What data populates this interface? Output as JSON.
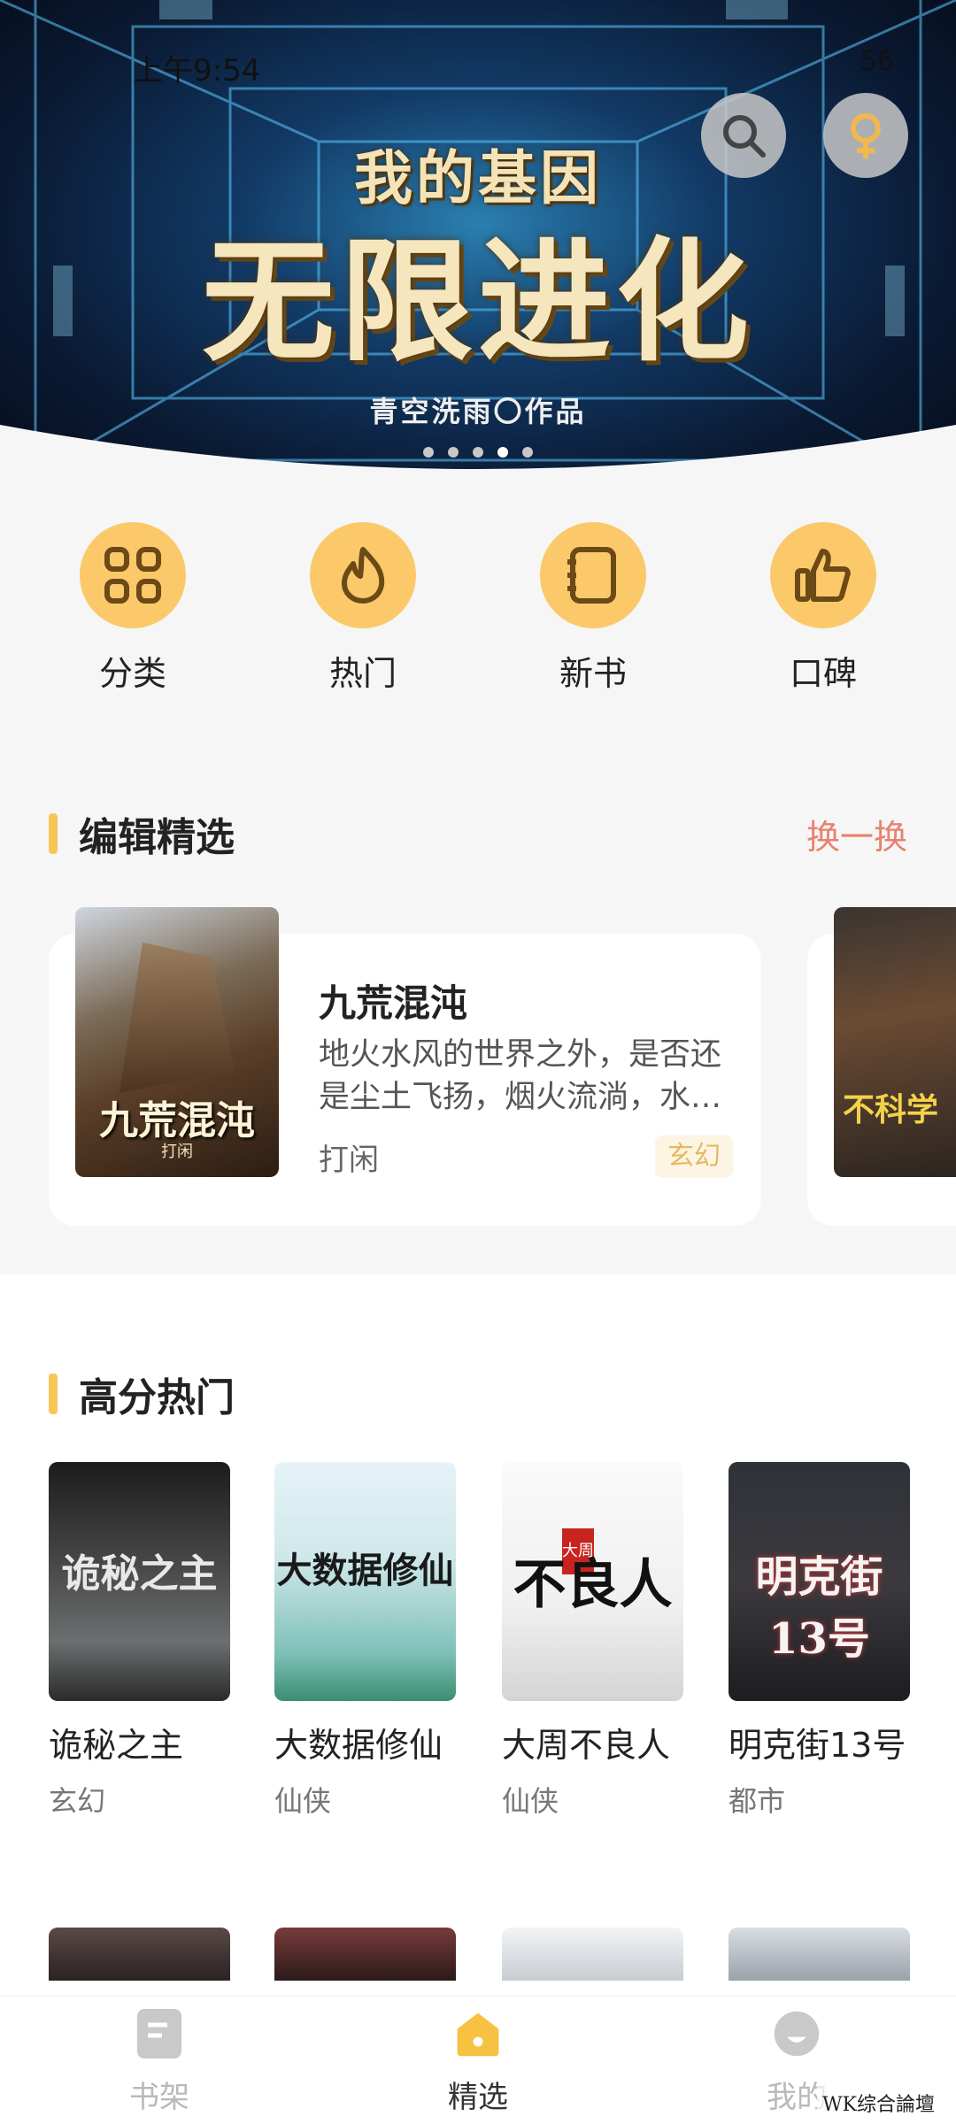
{
  "status_bar": {
    "time": "上午9:54",
    "right": "56"
  },
  "banner": {
    "title_top": "我的基因",
    "title_main": "无限进化",
    "byline": "青空洗雨〇作品",
    "dot_count": 5,
    "active_dot": 4
  },
  "quick_menu": [
    {
      "label": "分类",
      "icon": "grid-icon"
    },
    {
      "label": "热门",
      "icon": "flame-icon"
    },
    {
      "label": "新书",
      "icon": "notebook-icon"
    },
    {
      "label": "口碑",
      "icon": "thumbs-up-icon"
    }
  ],
  "editor_pick": {
    "title": "编辑精选",
    "swap_label": "换一换",
    "book": {
      "cover_title": "九荒混沌",
      "cover_sub": "打闲",
      "name": "九荒混沌",
      "description": "地火水风的世界之外，是否还是尘土飞扬，烟火流淌，水…",
      "author": "打闲",
      "tag": "玄幻"
    },
    "next_cover_title": "不科学"
  },
  "hot": {
    "title": "高分热门",
    "books": [
      {
        "name": "诡秘之主",
        "genre": "玄幻",
        "cover_title": "诡秘之主"
      },
      {
        "name": "大数据修仙",
        "genre": "仙侠",
        "cover_title": "大数据修仙"
      },
      {
        "name": "大周不良人",
        "genre": "仙侠",
        "cover_title": "不良人",
        "cover_stamp": "大周"
      },
      {
        "name": "明克街13号",
        "genre": "都市",
        "cover_title": "明克街13号"
      }
    ]
  },
  "bottom_nav": [
    {
      "label": "书架",
      "icon": "bookshelf-icon",
      "active": false
    },
    {
      "label": "精选",
      "icon": "home-icon",
      "active": true
    },
    {
      "label": "我的",
      "icon": "profile-icon",
      "active": false
    }
  ],
  "watermark": "WK综合論壇",
  "colors": {
    "accent": "#fbc96a",
    "swap": "#e8826e",
    "tag_bg": "#fdf5e4",
    "tag_text": "#e6b861"
  }
}
